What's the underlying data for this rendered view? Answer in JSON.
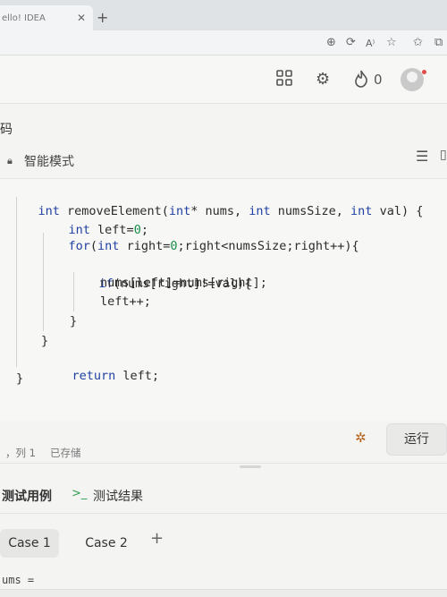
{
  "browser": {
    "tab_title": "ello! IDEA",
    "tab_close": "✕",
    "new_tab": "+",
    "toolbar_icons": [
      "zoom-icon",
      "refresh-icon",
      "read-aloud-icon",
      "favorite-icon",
      "favorites-bar-icon",
      "collections-icon"
    ]
  },
  "header": {
    "flame_count": "0"
  },
  "section_title": "码",
  "editor": {
    "mode_label": "智能模式",
    "code_lines": [
      "int removeElement(int* nums, int numsSize, int val) {",
      "    int left=0;",
      "    for(int right=0;right<numsSize;right++){",
      "",
      "        if(nums[right]!=val){",
      "            nums[left]=nums[right];",
      "            left++;",
      "        }",
      "    }",
      "    return left;",
      "}"
    ]
  },
  "statusbar": {
    "position": "，列 1",
    "saved": "已存储",
    "run_label": "运行"
  },
  "tests": {
    "tab_cases": "测试用例",
    "tab_results": "测试结果",
    "terminal_glyph": ">_",
    "cases": [
      "Case 1",
      "Case 2"
    ],
    "add_case": "+",
    "input_label": "ums ="
  },
  "colors": {
    "keyword": "#1f3fa3",
    "number": "#1a8a4a",
    "terminal_icon": "#2f9e4f"
  }
}
